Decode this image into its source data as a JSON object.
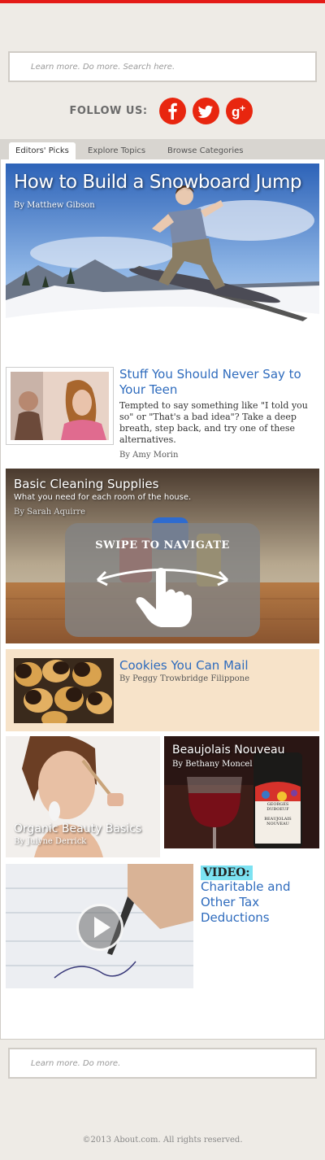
{
  "search_top": {
    "placeholder": "Learn more. Do more. Search here."
  },
  "follow": {
    "label": "FOLLOW US:",
    "networks": [
      "facebook-icon",
      "twitter-icon",
      "google-plus-icon"
    ]
  },
  "tabs": [
    {
      "label": "Editors' Picks",
      "active": true
    },
    {
      "label": "Explore Topics",
      "active": false
    },
    {
      "label": "Browse Categories",
      "active": false
    }
  ],
  "cards": {
    "snowboard": {
      "title": "How to Build a Snowboard Jump",
      "byline": "By Matthew Gibson"
    },
    "teen": {
      "title": "Stuff You Should Never Say to Your Teen",
      "description": "Tempted to say something like \"I told you so\" or \"That's a bad idea\"? Take a deep breath, step back, and try one of these alternatives.",
      "byline": "By Amy Morin"
    },
    "cleaning": {
      "title": "Basic Cleaning Supplies",
      "subtitle": "What you need for each room of the house.",
      "byline": "By Sarah Aquirre"
    },
    "swipe": {
      "label": "SWIPE TO NAVIGATE"
    },
    "cookies": {
      "title": "Cookies You Can Mail",
      "byline": "By Peggy Trowbridge Filippone"
    },
    "beauty": {
      "title": "Organic Beauty Basics",
      "byline": "By Julyne Derrick"
    },
    "wine": {
      "title": "Beaujolais Nouveau",
      "byline": "By Bethany Moncel",
      "label_text": "GEORGES DUBOEUF",
      "label_sub": "BEAUJOLAIS NOUVEAU"
    },
    "tax": {
      "badge": "VIDEO:",
      "title": "Charitable and Other Tax Deductions"
    }
  },
  "search_bottom": {
    "placeholder": "Learn more. Do more."
  },
  "footer": {
    "copyright": "©2013 About.com. All rights reserved."
  },
  "colors": {
    "accent": "#e41b17",
    "social": "#e8260f",
    "link": "#2e6bbd",
    "background": "#eeebe6",
    "cookie_bg": "#f7e3c9",
    "video_badge": "#7ce2f2"
  }
}
